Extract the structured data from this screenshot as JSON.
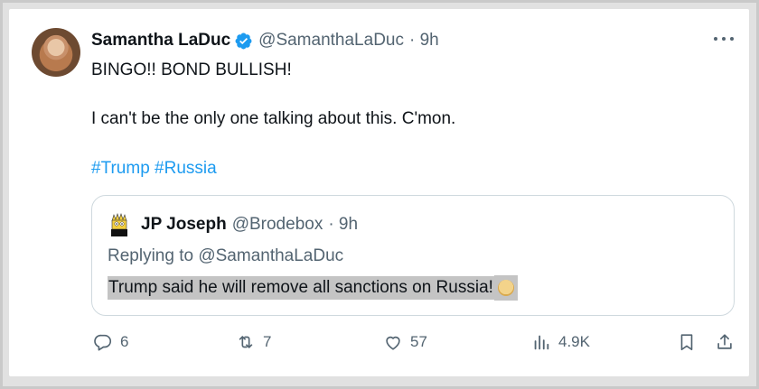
{
  "tweet": {
    "author_name": "Samantha LaDuc",
    "author_handle": "@SamanthaLaDuc",
    "time": "· 9h",
    "line1": "BINGO!! BOND BULLISH!",
    "line2": "I can't be the only one talking about this. C'mon.",
    "hashtags": [
      "#Trump",
      "#Russia"
    ]
  },
  "quote": {
    "author_name": "JP Joseph",
    "author_handle": "@Brodebox",
    "time": "· 9h",
    "replying_prefix": "Replying to",
    "replying_handle": "@SamanthaLaDuc",
    "text": "Trump said he will remove all sanctions on Russia!",
    "emoji": "wink-face"
  },
  "actions": {
    "replies": "6",
    "retweets": "7",
    "likes": "57",
    "views": "4.9K"
  },
  "colors": {
    "link": "#1d9bf0",
    "muted": "#536471",
    "text": "#0f1419",
    "highlight": "#c4c4c4"
  }
}
